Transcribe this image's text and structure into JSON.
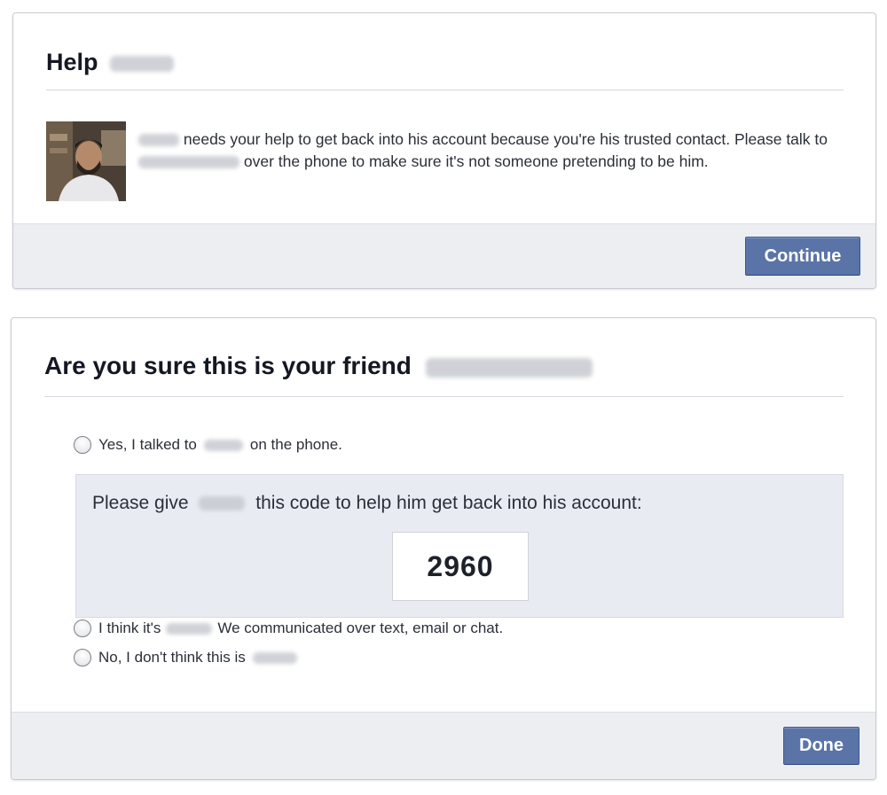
{
  "help_card": {
    "title": "Help",
    "message": {
      "part1": "needs your help to get back into his account because you're his trusted contact. Please talk to",
      "part2": "over the phone to make sure it's not someone pretending to be him."
    },
    "continue_label": "Continue"
  },
  "confirm_card": {
    "title": "Are you sure this is your friend",
    "options": {
      "yes": {
        "before": "Yes, I talked to",
        "after": "on the phone."
      },
      "think": {
        "before": "I think it's",
        "after": "We communicated over text, email or chat."
      },
      "no": {
        "before": "No, I don't think this is",
        "after": ""
      }
    },
    "code_panel": {
      "before": "Please give",
      "after": "this code to help him get back into his account:",
      "code": "2960"
    },
    "done_label": "Done"
  },
  "colors": {
    "button_blue": "#5b74a8",
    "footer_gray": "#eceef1",
    "panel_lavender": "#e9ebf2"
  }
}
